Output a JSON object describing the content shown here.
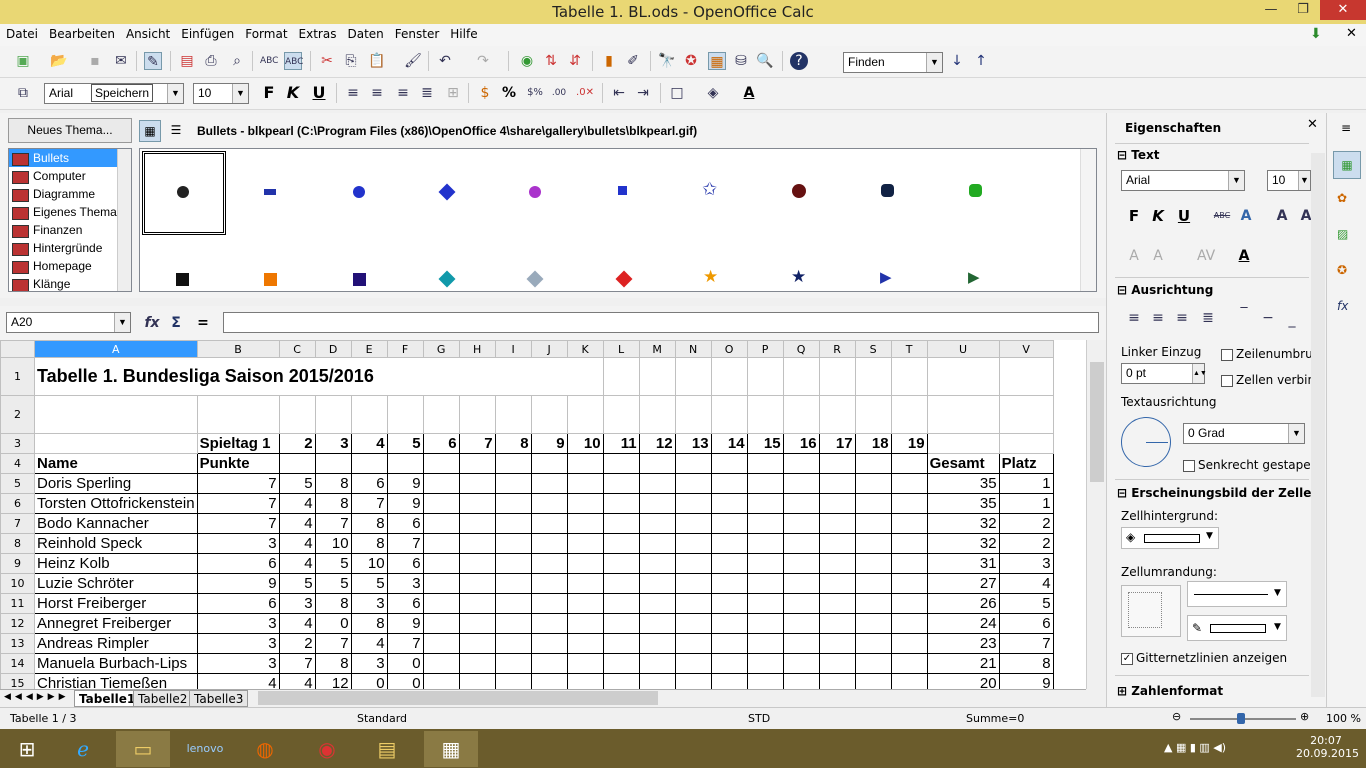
{
  "window": {
    "title": "Tabelle 1. BL.ods - OpenOffice Calc"
  },
  "menu": [
    "Datei",
    "Bearbeiten",
    "Ansicht",
    "Einfügen",
    "Format",
    "Extras",
    "Daten",
    "Fenster",
    "Hilfe"
  ],
  "toolbar": {
    "find_placeholder": "Finden",
    "font": "Arial",
    "tooltip": "Speichern",
    "size": "10"
  },
  "gallery": {
    "new_theme_button": "Neues Thema...",
    "path": "Bullets - blkpearl (C:\\Program Files (x86)\\OpenOffice 4\\share\\gallery\\bullets\\blkpearl.gif)",
    "themes": [
      "Bullets",
      "Computer",
      "Diagramme",
      "Eigenes Thema",
      "Finanzen",
      "Hintergründe",
      "Homepage",
      "Klänge"
    ]
  },
  "formula": {
    "cell_ref": "A20",
    "sum_symbol": "Σ",
    "equals": "=",
    "content": ""
  },
  "sheet": {
    "columns": [
      "A",
      "B",
      "C",
      "D",
      "E",
      "F",
      "G",
      "H",
      "I",
      "J",
      "K",
      "L",
      "M",
      "N",
      "O",
      "P",
      "Q",
      "R",
      "S",
      "T",
      "U",
      "V"
    ],
    "title": "Tabelle 1. Bundesliga Saison 2015/2016",
    "spieltag_label": "Spieltag 1",
    "spieltage": [
      "2",
      "3",
      "4",
      "5",
      "6",
      "7",
      "8",
      "9",
      "10",
      "11",
      "12",
      "13",
      "14",
      "15",
      "16",
      "17",
      "18",
      "19"
    ],
    "header_name": "Name",
    "header_punkte": "Punkte",
    "header_gesamt": "Gesamt",
    "header_platz": "Platz",
    "rows": [
      {
        "row": "5",
        "name": "Doris Sperling",
        "v": [
          "7",
          "5",
          "8",
          "6",
          "9"
        ],
        "gesamt": "35",
        "platz": "1"
      },
      {
        "row": "6",
        "name": "Torsten Ottofrickenstein",
        "v": [
          "7",
          "4",
          "8",
          "7",
          "9"
        ],
        "gesamt": "35",
        "platz": "1"
      },
      {
        "row": "7",
        "name": "Bodo Kannacher",
        "v": [
          "7",
          "4",
          "7",
          "8",
          "6"
        ],
        "gesamt": "32",
        "platz": "2"
      },
      {
        "row": "8",
        "name": "Reinhold Speck",
        "v": [
          "3",
          "4",
          "10",
          "8",
          "7"
        ],
        "gesamt": "32",
        "platz": "2"
      },
      {
        "row": "9",
        "name": "Heinz Kolb",
        "v": [
          "6",
          "4",
          "5",
          "10",
          "6"
        ],
        "gesamt": "31",
        "platz": "3"
      },
      {
        "row": "10",
        "name": "Luzie Schröter",
        "v": [
          "9",
          "5",
          "5",
          "5",
          "3"
        ],
        "gesamt": "27",
        "platz": "4"
      },
      {
        "row": "11",
        "name": "Horst Freiberger",
        "v": [
          "6",
          "3",
          "8",
          "3",
          "6"
        ],
        "gesamt": "26",
        "platz": "5"
      },
      {
        "row": "12",
        "name": "Annegret Freiberger",
        "v": [
          "3",
          "4",
          "0",
          "8",
          "9"
        ],
        "gesamt": "24",
        "platz": "6"
      },
      {
        "row": "13",
        "name": "Andreas Rimpler",
        "v": [
          "3",
          "2",
          "7",
          "4",
          "7"
        ],
        "gesamt": "23",
        "platz": "7"
      },
      {
        "row": "14",
        "name": "Manuela Burbach-Lips",
        "v": [
          "3",
          "7",
          "8",
          "3",
          "0"
        ],
        "gesamt": "21",
        "platz": "8"
      },
      {
        "row": "15",
        "name": "Christian Tiemeßen",
        "v": [
          "4",
          "4",
          "12",
          "0",
          "0"
        ],
        "gesamt": "20",
        "platz": "9"
      }
    ],
    "tabs": [
      "Tabelle1",
      "Tabelle2",
      "Tabelle3"
    ]
  },
  "status": {
    "sheet": "Tabelle 1 / 3",
    "style": "Standard",
    "mode": "STD",
    "sum": "Summe=0",
    "zoom": "100 %"
  },
  "sidebar": {
    "title": "Eigenschaften",
    "text_section": "Text",
    "font": "Arial",
    "size": "10",
    "align_section": "Ausrichtung",
    "indent_label": "Linker Einzug",
    "indent_value": "0 pt",
    "wrap_label": "Zeilenumbru",
    "merge_label": "Zellen verbin",
    "orientation_label": "Textausrichtung",
    "angle_value": "0 Grad",
    "vertical_stacked": "Senkrecht gestapelt",
    "cell_appearance_section": "Erscheinungsbild der Zelle",
    "bg_label": "Zellhintergrund:",
    "border_label": "Zellumrandung:",
    "gridlines_label": "Gitternetzlinien anzeigen",
    "numformat_section": "Zahlenformat"
  },
  "taskbar": {
    "time": "20:07",
    "date": "20.09.2015"
  }
}
